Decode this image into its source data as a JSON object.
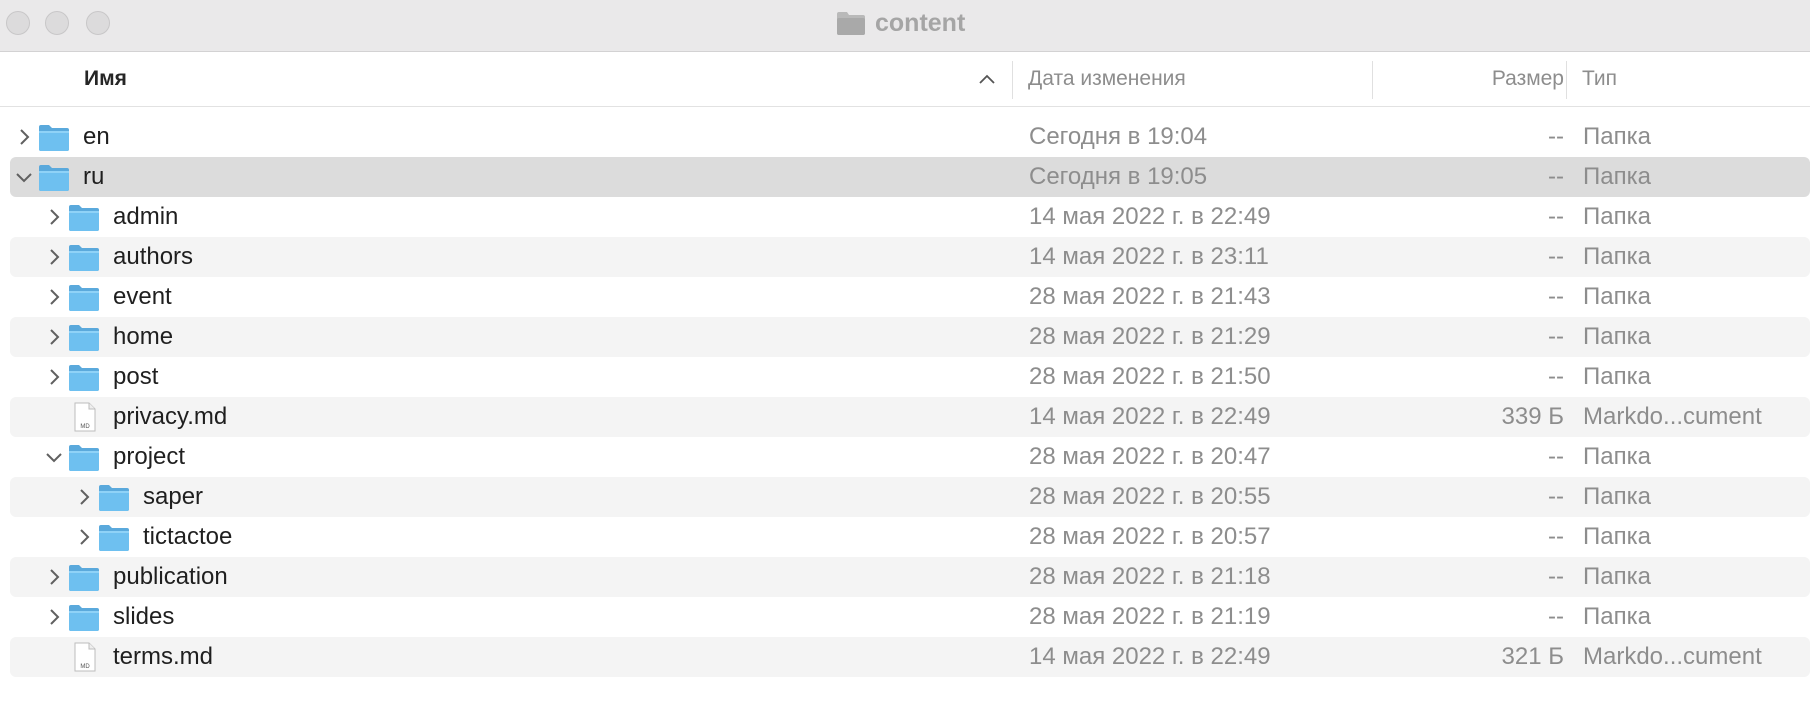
{
  "window": {
    "title": "content"
  },
  "columns": {
    "name": "Имя",
    "date": "Дата изменения",
    "size": "Размер",
    "type": "Тип"
  },
  "rows": [
    {
      "name": "en",
      "date": "Сегодня в 19:04",
      "size": "--",
      "type": "Папка",
      "level": 0,
      "kind": "folder",
      "expanded": false
    },
    {
      "name": "ru",
      "date": "Сегодня в 19:05",
      "size": "--",
      "type": "Папка",
      "level": 0,
      "kind": "folder",
      "expanded": true,
      "selected": true
    },
    {
      "name": "admin",
      "date": "14 мая 2022 г. в 22:49",
      "size": "--",
      "type": "Папка",
      "level": 1,
      "kind": "folder",
      "expanded": false
    },
    {
      "name": "authors",
      "date": "14 мая 2022 г. в 23:11",
      "size": "--",
      "type": "Папка",
      "level": 1,
      "kind": "folder",
      "expanded": false
    },
    {
      "name": "event",
      "date": "28 мая 2022 г. в 21:43",
      "size": "--",
      "type": "Папка",
      "level": 1,
      "kind": "folder",
      "expanded": false
    },
    {
      "name": "home",
      "date": "28 мая 2022 г. в 21:29",
      "size": "--",
      "type": "Папка",
      "level": 1,
      "kind": "folder",
      "expanded": false
    },
    {
      "name": "post",
      "date": "28 мая 2022 г. в 21:50",
      "size": "--",
      "type": "Папка",
      "level": 1,
      "kind": "folder",
      "expanded": false
    },
    {
      "name": "privacy.md",
      "date": "14 мая 2022 г. в 22:49",
      "size": "339 Б",
      "type": "Markdo...cument",
      "level": 1,
      "kind": "file",
      "file_badge": "MD"
    },
    {
      "name": "project",
      "date": "28 мая 2022 г. в 20:47",
      "size": "--",
      "type": "Папка",
      "level": 1,
      "kind": "folder",
      "expanded": true
    },
    {
      "name": "saper",
      "date": "28 мая 2022 г. в 20:55",
      "size": "--",
      "type": "Папка",
      "level": 2,
      "kind": "folder",
      "expanded": false
    },
    {
      "name": "tictactoe",
      "date": "28 мая 2022 г. в 20:57",
      "size": "--",
      "type": "Папка",
      "level": 2,
      "kind": "folder",
      "expanded": false
    },
    {
      "name": "publication",
      "date": "28 мая 2022 г. в 21:18",
      "size": "--",
      "type": "Папка",
      "level": 1,
      "kind": "folder",
      "expanded": false
    },
    {
      "name": "slides",
      "date": "28 мая 2022 г. в 21:19",
      "size": "--",
      "type": "Папка",
      "level": 1,
      "kind": "folder",
      "expanded": false
    },
    {
      "name": "terms.md",
      "date": "14 мая 2022 г. в 22:49",
      "size": "321 Б",
      "type": "Markdo...cument",
      "level": 1,
      "kind": "file",
      "file_badge": "MD"
    }
  ],
  "colors": {
    "folder": "#6ec0f0",
    "folder_tab": "#5aa9dc",
    "selected_row": "#dcdcdc",
    "alt_row": "#f4f4f4"
  }
}
